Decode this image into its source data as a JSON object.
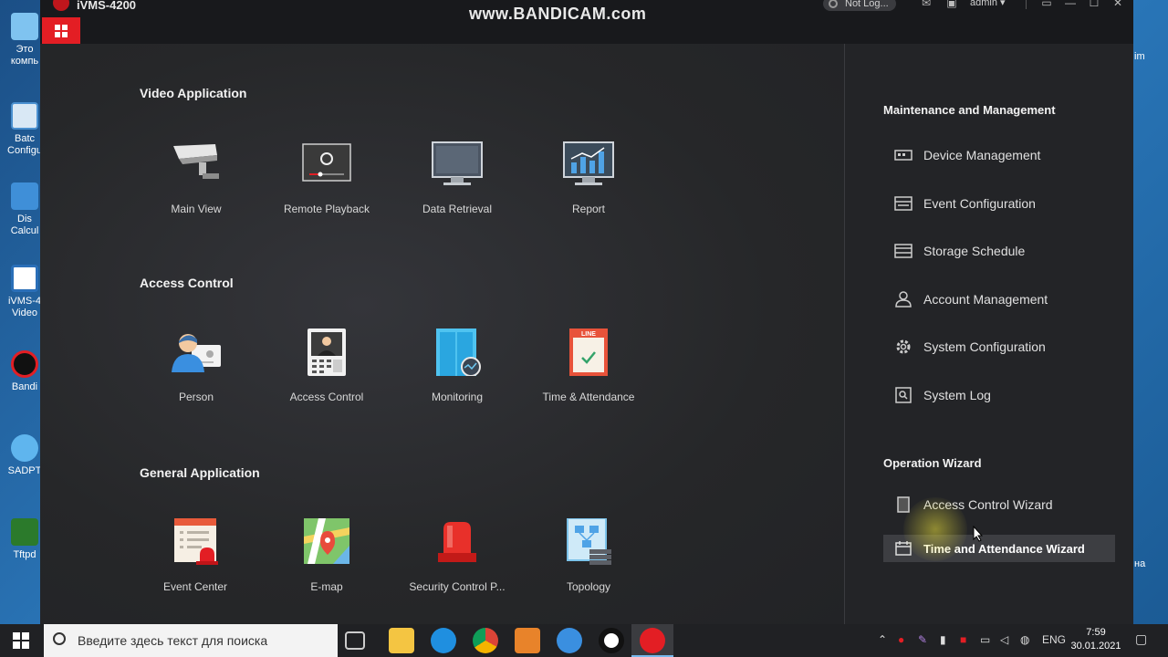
{
  "desktop": {
    "icons": [
      {
        "label": "Это компь"
      },
      {
        "label": "Batc Configu"
      },
      {
        "label": "Dis Calcul"
      },
      {
        "label": "iVMS-4 Video"
      },
      {
        "label": "Bandi"
      },
      {
        "label": "SADPT"
      },
      {
        "label": "Tftpd"
      }
    ],
    "right_edge": [
      "im",
      "на"
    ]
  },
  "window": {
    "title": "iVMS-4200",
    "watermark": "www.BANDICAM.com",
    "status": "Not Log...",
    "user": "admin"
  },
  "sections": [
    {
      "title": "Video Application",
      "tiles": [
        {
          "label": "Main View",
          "icon": "camera-icon"
        },
        {
          "label": "Remote Playback",
          "icon": "playback-icon"
        },
        {
          "label": "Data Retrieval",
          "icon": "monitor-icon"
        },
        {
          "label": "Report",
          "icon": "report-chart-icon"
        }
      ]
    },
    {
      "title": "Access Control",
      "tiles": [
        {
          "label": "Person",
          "icon": "person-icon"
        },
        {
          "label": "Access Control",
          "icon": "access-terminal-icon"
        },
        {
          "label": "Monitoring",
          "icon": "door-monitor-icon"
        },
        {
          "label": "Time & Attendance",
          "icon": "calendar-icon"
        }
      ]
    },
    {
      "title": "General Application",
      "tiles": [
        {
          "label": "Event Center",
          "icon": "event-alarm-icon"
        },
        {
          "label": "E-map",
          "icon": "map-pin-icon"
        },
        {
          "label": "Security Control P...",
          "icon": "siren-icon"
        },
        {
          "label": "Topology",
          "icon": "topology-icon"
        }
      ]
    }
  ],
  "calendar_badge": "LINE",
  "side": {
    "maintenance_title": "Maintenance and Management",
    "maintenance": [
      {
        "label": "Device Management",
        "icon": "device-icon"
      },
      {
        "label": "Event Configuration",
        "icon": "event-config-icon"
      },
      {
        "label": "Storage Schedule",
        "icon": "storage-icon"
      },
      {
        "label": "Account Management",
        "icon": "account-icon"
      },
      {
        "label": "System Configuration",
        "icon": "gear-icon"
      },
      {
        "label": "System Log",
        "icon": "log-icon"
      }
    ],
    "wizard_title": "Operation Wizard",
    "wizard": [
      {
        "label": "Access Control Wizard",
        "icon": "access-wizard-icon"
      },
      {
        "label": "Time and Attendance Wizard",
        "icon": "attendance-wizard-icon"
      }
    ]
  },
  "taskbar": {
    "search_placeholder": "Введите здесь текст для поиска",
    "lang": "ENG",
    "time": "7:59",
    "date": "30.01.2021"
  },
  "colors": {
    "accent_red": "#e31e24",
    "window_bg": "#222327",
    "taskbar_bg": "#202124"
  }
}
